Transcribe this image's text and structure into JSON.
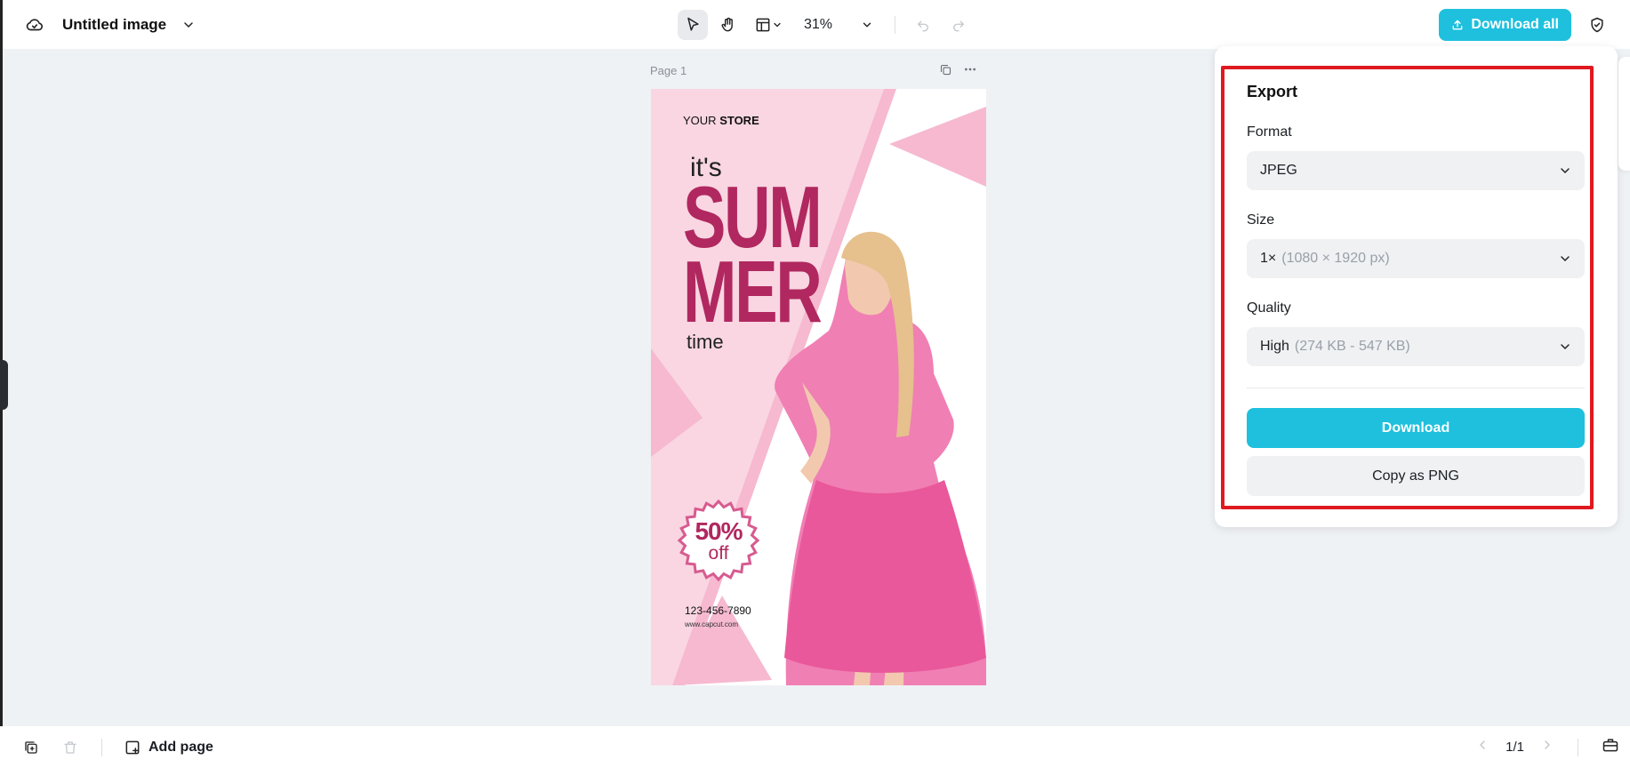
{
  "header": {
    "doc_title": "Untitled image",
    "zoom": "31%",
    "download_all_label": "Download all",
    "icons": [
      "cloud-icon",
      "chevron-down-icon",
      "select-tool-icon",
      "hand-tool-icon",
      "layout-icon",
      "undo-icon",
      "redo-icon",
      "shield-icon"
    ]
  },
  "canvas": {
    "page_label": "Page 1",
    "poster": {
      "store_prefix": "YOUR",
      "store_name": "STORE",
      "its": "it's",
      "big_word_1": "SUM",
      "big_word_2": "MER",
      "time": "time",
      "badge_percent": "50%",
      "badge_off": "off",
      "phone": "123-456-7890",
      "website": "www.capcut.com"
    }
  },
  "export_panel": {
    "title": "Export",
    "format_label": "Format",
    "format_value": "JPEG",
    "size_label": "Size",
    "size_value": "1×",
    "size_detail": "(1080 × 1920 px)",
    "quality_label": "Quality",
    "quality_value": "High",
    "quality_detail": "(274 KB - 547 KB)",
    "download_label": "Download",
    "copy_label": "Copy as PNG"
  },
  "footer": {
    "add_page_label": "Add page",
    "page_indicator": "1/1"
  },
  "colors": {
    "accent": "#1ec0de",
    "highlight": "#e0191f",
    "poster_magenta": "#b0285f",
    "poster_pink": "#f9d6e2"
  }
}
